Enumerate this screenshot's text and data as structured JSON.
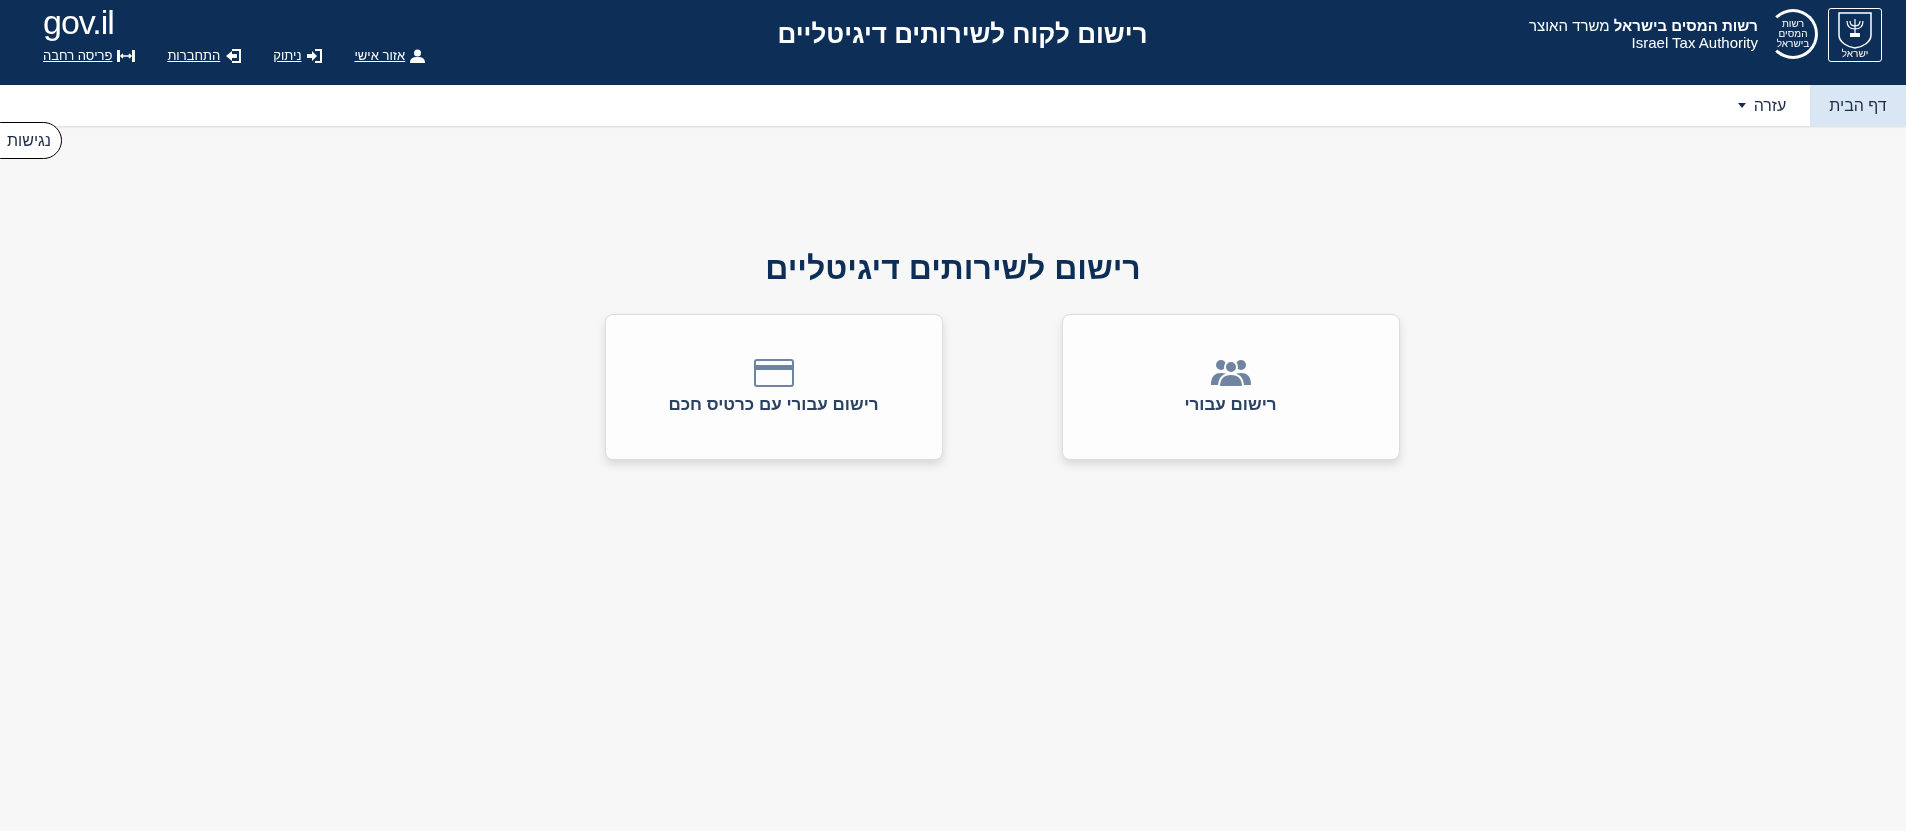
{
  "header": {
    "emblem_caption": "ישראל",
    "tax_logo_lines": [
      "רשות",
      "המסים",
      "בישראל"
    ],
    "authority_name": "**רשות המסים בישראל** משרד האוצר",
    "authority_name_en": "Israel Tax Authority",
    "title": "רישום לקוח לשירותים דיגיטליים",
    "gov_logo": "gov.il",
    "links": [
      {
        "kind": "user",
        "label": "אזור אישי"
      },
      {
        "kind": "logout",
        "label": "ניתוק"
      },
      {
        "kind": "login",
        "label": "התחברות"
      },
      {
        "kind": "wide",
        "label": "פריסה רחבה"
      }
    ]
  },
  "nav": [
    {
      "label": "דף הבית",
      "selected": true,
      "has_menu": false
    },
    {
      "label": "עזרה",
      "selected": false,
      "has_menu": true
    }
  ],
  "accessibility_button": "נגישות",
  "heading": "רישום לשירותים דיגיטליים",
  "cards": [
    {
      "kind": "people",
      "label": "רישום עבורי"
    },
    {
      "kind": "card",
      "label": "רישום עבורי עם כרטיס חכם"
    }
  ]
}
